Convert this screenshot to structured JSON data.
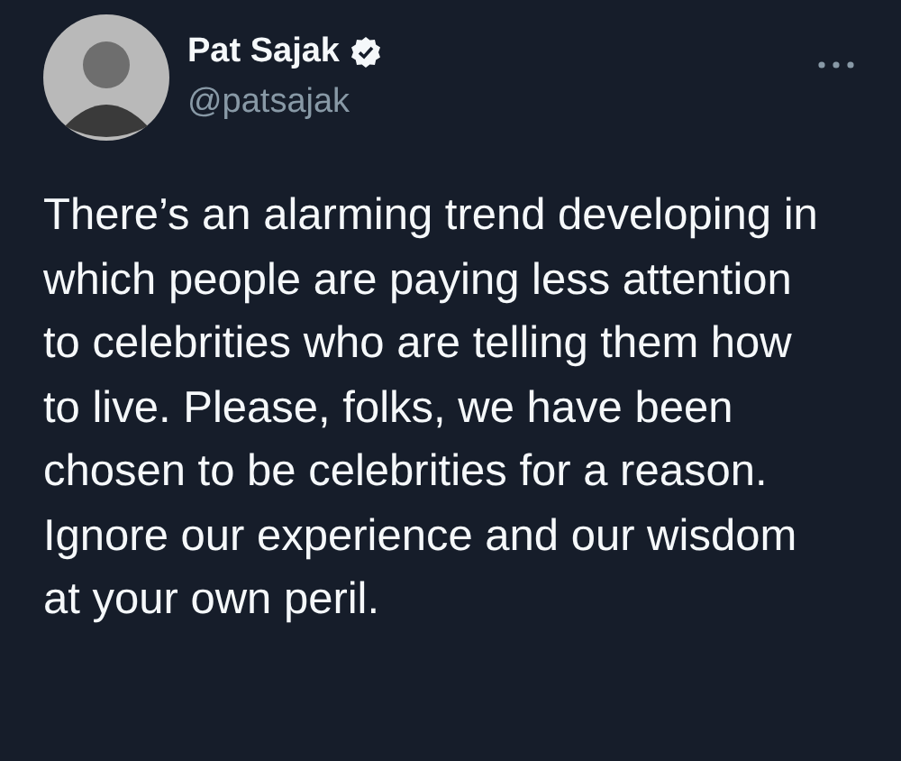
{
  "author": {
    "name": "Pat Sajak",
    "verified": true,
    "handle": "@patsajak"
  },
  "text": "There’s an alarming trend developing in which people are paying less attention to celebrities who are telling them how to live. Please, folks, we have been chosen to be celebrities for a reason. Ignore our experience and our wisdom at your own peril."
}
